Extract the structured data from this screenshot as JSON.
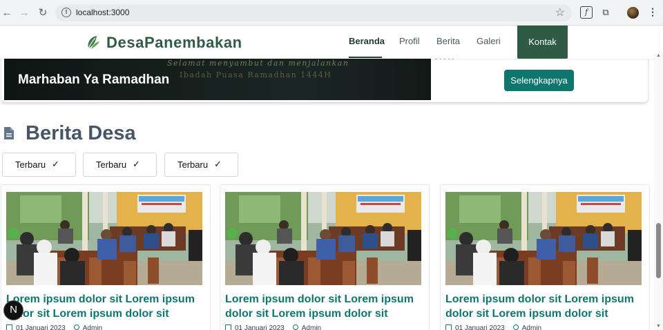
{
  "browser": {
    "url": "localhost:3000"
  },
  "header": {
    "brand": "DesaPanembakan",
    "nav": [
      "Beranda",
      "Profil",
      "Berita",
      "Galeri"
    ],
    "contact": "Kontak"
  },
  "hero": {
    "line1": "Selamat menyambut dan menjalankan",
    "line2": "Ibadah Puasa Ramadhan 1444H",
    "title": "Marhaban Ya Ramadhan",
    "button": "Selengkapnya"
  },
  "section": {
    "title": "Berita Desa"
  },
  "filters": [
    "Terbaru",
    "Terbaru",
    "Terbaru"
  ],
  "cards": [
    {
      "title": "Lorem ipsum dolor sit Lorem ipsum dolor sit Lorem ipsum dolor sit",
      "date": "01 Januari 2023",
      "author": "Admin"
    },
    {
      "title": "Lorem ipsum dolor sit Lorem ipsum dolor sit Lorem ipsum dolor sit",
      "date": "01 Januari 2023",
      "author": "Admin"
    },
    {
      "title": "Lorem ipsum dolor sit Lorem ipsum dolor sit Lorem ipsum dolor sit",
      "date": "01 Januari 2023",
      "author": "Admin"
    }
  ],
  "badge": "N",
  "colors": {
    "brand": "#2f5a43",
    "accent": "#0f766e",
    "heading": "#475569"
  }
}
